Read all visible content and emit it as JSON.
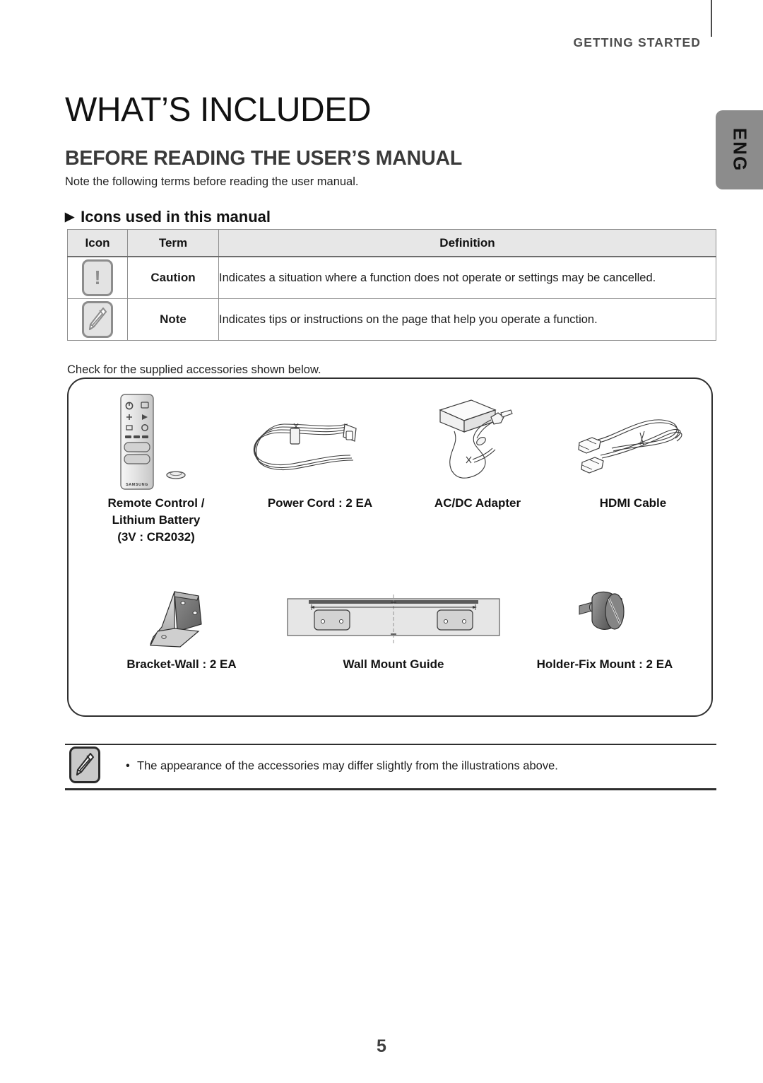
{
  "header": {
    "eyebrow": "GETTING STARTED",
    "language_tab": "ENG"
  },
  "page_title": "WHAT’S INCLUDED",
  "section_title": "BEFORE READING THE USER’S MANUAL",
  "intro_text": "Note the following terms before reading the user manual.",
  "subsection": {
    "marker": "▶",
    "title": "Icons used in this manual"
  },
  "icon_table": {
    "headers": [
      "Icon",
      "Term",
      "Definition"
    ],
    "rows": [
      {
        "icon_name": "caution-icon",
        "term": "Caution",
        "definition": "Indicates a situation where a function does not operate or settings may be cancelled."
      },
      {
        "icon_name": "note-icon",
        "term": "Note",
        "definition": "Indicates tips or instructions on the page that help you operate a function."
      }
    ]
  },
  "check_text": "Check for the supplied accessories shown below.",
  "accessories": [
    {
      "illustration": "remote-control-illustration",
      "label_lines": [
        "Remote Control /",
        "Lithium Battery",
        "(3V : CR2032)"
      ]
    },
    {
      "illustration": "power-cord-illustration",
      "label_lines": [
        "Power Cord : 2 EA"
      ]
    },
    {
      "illustration": "ac-dc-adapter-illustration",
      "label_lines": [
        "AC/DC Adapter"
      ]
    },
    {
      "illustration": "hdmi-cable-illustration",
      "label_lines": [
        "HDMI Cable"
      ]
    },
    {
      "illustration": "bracket-wall-illustration",
      "label_lines": [
        "Bracket-Wall : 2 EA"
      ]
    },
    {
      "illustration": "wall-mount-guide-illustration",
      "label_lines": [
        "Wall Mount Guide"
      ]
    },
    {
      "illustration": "holder-fix-mount-illustration",
      "label_lines": [
        "Holder-Fix Mount : 2 EA"
      ]
    }
  ],
  "bottom_note": {
    "bullet": "•",
    "text": "The appearance of the accessories may differ slightly from the illustrations above."
  },
  "page_number": "5",
  "colors": {
    "lang_tab_bg": "#8c8c8c",
    "table_header_bg": "#e7e7e7",
    "rule": "#2e2e2e",
    "icon_gray": "#8d8d8d"
  }
}
